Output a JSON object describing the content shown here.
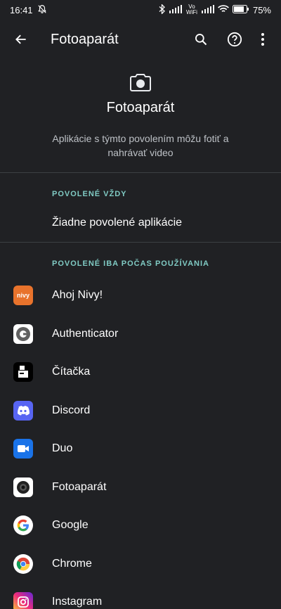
{
  "status_bar": {
    "time": "16:41",
    "battery": "75%",
    "network_label": "Vo WiFi"
  },
  "appbar": {
    "title": "Fotoaparát"
  },
  "header": {
    "title": "Fotoaparát",
    "description": "Aplikácie s týmto povolením môžu fotiť a nahrávať video"
  },
  "sections": {
    "always": {
      "label": "POVOLENÉ VŽDY",
      "empty_text": "Žiadne povolené aplikácie"
    },
    "while_using": {
      "label": "POVOLENÉ IBA POČAS POUŽÍVANIA",
      "apps": [
        {
          "name": "Ahoj Nivy!",
          "icon": "nivy-icon",
          "icon_text": "nivy"
        },
        {
          "name": "Authenticator",
          "icon": "authenticator-icon"
        },
        {
          "name": "Čítačka",
          "icon": "citacka-icon"
        },
        {
          "name": "Discord",
          "icon": "discord-icon"
        },
        {
          "name": "Duo",
          "icon": "duo-icon"
        },
        {
          "name": "Fotoaparát",
          "icon": "camera-app-icon"
        },
        {
          "name": "Google",
          "icon": "google-icon"
        },
        {
          "name": "Chrome",
          "icon": "chrome-icon"
        },
        {
          "name": "Instagram",
          "icon": "instagram-icon"
        }
      ]
    }
  },
  "colors": {
    "background": "#202124",
    "accent": "#80cbc4",
    "divider": "#3c4043"
  }
}
